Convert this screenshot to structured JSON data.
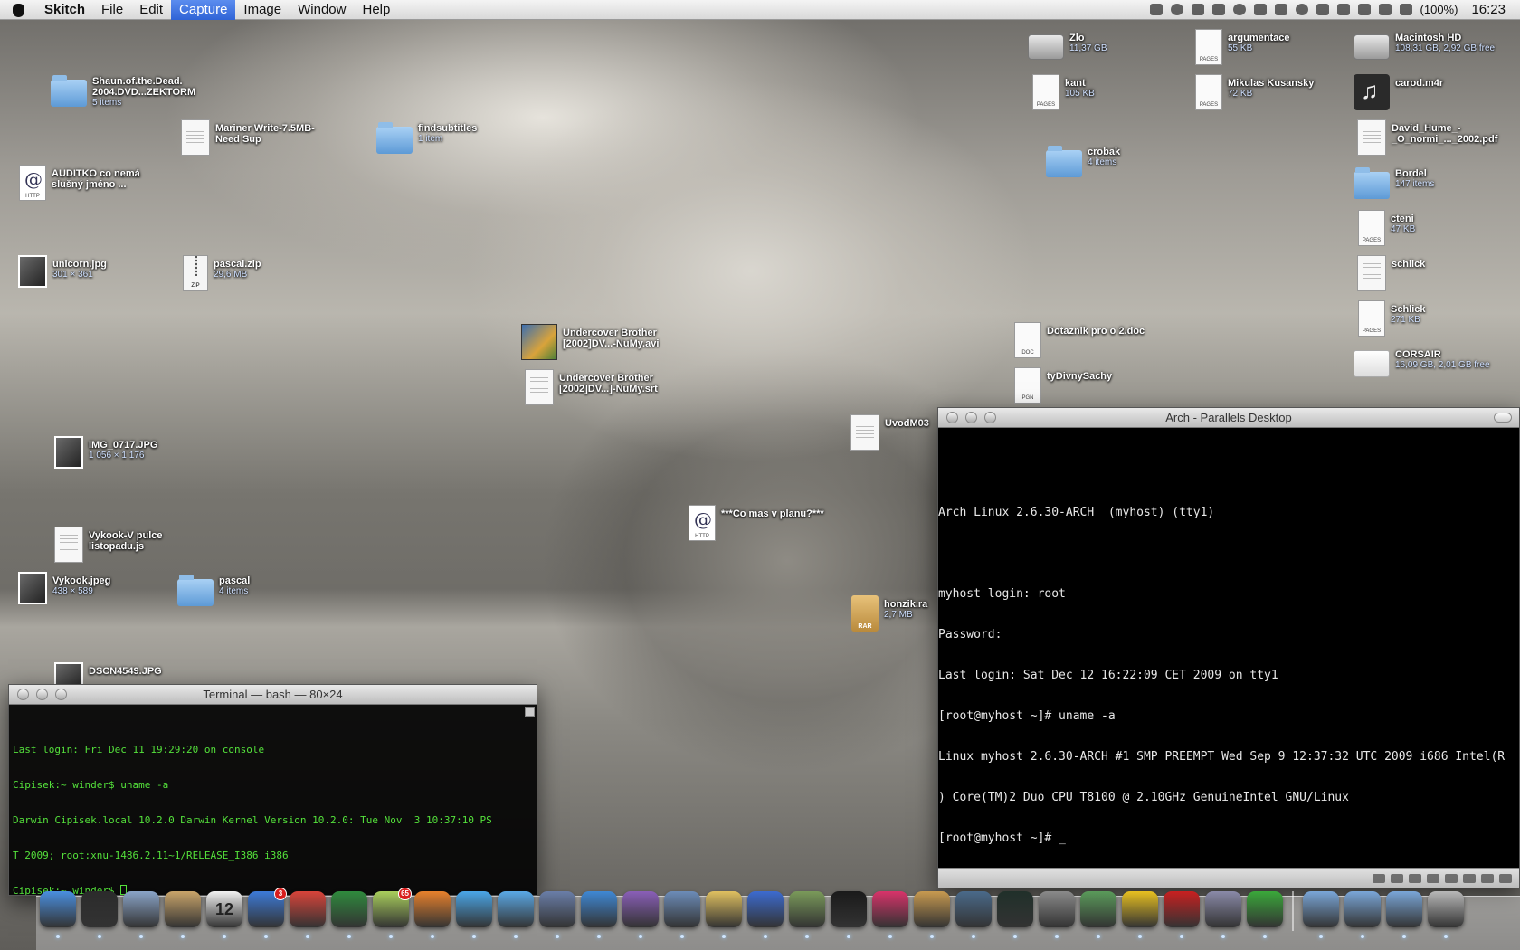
{
  "menubar": {
    "app_name": "Skitch",
    "menus": [
      "File",
      "Edit",
      "Capture",
      "Image",
      "Window",
      "Help"
    ],
    "active_menu": "Capture",
    "battery": "(100%)",
    "clock": "16:23"
  },
  "desktop_icons": [
    {
      "name": "Shaun.of.the.Dead.\n2004.DVD...ZEKTORM",
      "info": "5 items",
      "icon": "folder-icon"
    },
    {
      "name": "Mariner Write-7.5MB-\nNeed Sup",
      "info": "",
      "icon": "document-icon"
    },
    {
      "name": "findsubtitles",
      "info": "1 item",
      "icon": "folder-icon"
    },
    {
      "name": "AUDITKO co nemá\nslušný jméno ...",
      "info": "",
      "icon": "webloc-icon",
      "tag": "HTTP"
    },
    {
      "name": "unicorn.jpg",
      "info": "301 × 361",
      "icon": "image-icon"
    },
    {
      "name": "pascal.zip",
      "info": "29,6 MB",
      "icon": "zip-icon",
      "tag": "ZIP"
    },
    {
      "name": "Undercover Brother\n[2002]DV...-NuMy.avi",
      "info": "",
      "icon": "movie-icon"
    },
    {
      "name": "Undercover Brother\n[2002]DV...]-NuMy.srt",
      "info": "",
      "icon": "document-icon"
    },
    {
      "name": "IMG_0717.JPG",
      "info": "1 056 × 1 176",
      "icon": "image-icon"
    },
    {
      "name": "Vykook-V pulce\nlistopadu.js",
      "info": "",
      "icon": "document-icon"
    },
    {
      "name": "Vykook.jpeg",
      "info": "438 × 589",
      "icon": "image-icon"
    },
    {
      "name": "pascal",
      "info": "4 items",
      "icon": "folder-icon"
    },
    {
      "name": "DSCN4549.JPG",
      "info": "",
      "icon": "image-icon"
    },
    {
      "name": "***Co mas v planu?***",
      "info": "",
      "icon": "webloc-icon",
      "tag": "HTTP"
    },
    {
      "name": "UvodM03",
      "info": "",
      "icon": "document-icon"
    },
    {
      "name": "honzik.ra",
      "info": "2,7 MB",
      "icon": "rar-icon",
      "tag": "RAR"
    },
    {
      "name": "Zlo",
      "info": "11,37 GB",
      "icon": "hard-drive-icon"
    },
    {
      "name": "kant",
      "info": "105 KB",
      "icon": "pages-icon",
      "tag": "PAGES"
    },
    {
      "name": "crobak",
      "info": "4 items",
      "icon": "folder-icon"
    },
    {
      "name": "Dotaznik pro o 2.doc",
      "info": "",
      "icon": "doc-icon",
      "tag": "DOC"
    },
    {
      "name": "tyDivnySachy",
      "info": "",
      "icon": "pgn-icon",
      "tag": "PGN"
    },
    {
      "name": "argumentace",
      "info": "55 KB",
      "icon": "pages-icon",
      "tag": "PAGES"
    },
    {
      "name": "Mikulas Kusansky",
      "info": "72 KB",
      "icon": "pages-icon",
      "tag": "PAGES"
    },
    {
      "name": "Macintosh HD",
      "info": "108,31 GB, 2,92 GB free",
      "icon": "hard-drive-icon"
    },
    {
      "name": "carod.m4r",
      "info": "",
      "icon": "music-icon"
    },
    {
      "name": "David_Hume_-\n_O_normi_..._2002.pdf",
      "info": "",
      "icon": "pdf-icon"
    },
    {
      "name": "Bordel",
      "info": "147 items",
      "icon": "folder-icon"
    },
    {
      "name": "cteni",
      "info": "47 KB",
      "icon": "pages-icon",
      "tag": "PAGES"
    },
    {
      "name": "schlick",
      "info": "",
      "icon": "document-icon"
    },
    {
      "name": "Schlick",
      "info": "271 KB",
      "icon": "pages-icon",
      "tag": "PAGES"
    },
    {
      "name": "CORSAIR",
      "info": "16,09 GB, 2,01 GB free",
      "icon": "usb-drive-icon"
    }
  ],
  "terminal": {
    "title": "Terminal — bash — 80×24",
    "lines": [
      "Last login: Fri Dec 11 19:29:20 on console",
      "Cipisek:~ winder$ uname -a",
      "Darwin Cipisek.local 10.2.0 Darwin Kernel Version 10.2.0: Tue Nov  3 10:37:10 PS",
      "T 2009; root:xnu-1486.2.11~1/RELEASE_I386 i386",
      "Cipisek:~ winder$ "
    ]
  },
  "parallels": {
    "title": "Arch - Parallels Desktop",
    "lines": [
      "Arch Linux 2.6.30-ARCH  (myhost) (tty1)",
      "",
      "myhost login: root",
      "Password:",
      "Last login: Sat Dec 12 16:22:09 CET 2009 on tty1",
      "[root@myhost ~]# uname -a",
      "Linux myhost 2.6.30-ARCH #1 SMP PREEMPT Wed Sep 9 12:37:32 UTC 2009 i686 Intel(R",
      ") Core(TM)2 Duo CPU T8100 @ 2.10GHz GenuineIntel GNU/Linux",
      "[root@myhost ~]# _"
    ]
  },
  "dock": {
    "apps": [
      {
        "name": "finder-icon",
        "color": "#4a8fe0"
      },
      {
        "name": "dashboard-icon",
        "color": "#2b2b2b"
      },
      {
        "name": "mail-icon",
        "color": "#8aa4c8"
      },
      {
        "name": "address-book-icon",
        "color": "#c9a46a"
      },
      {
        "name": "ical-icon",
        "color": "#f2f2f2",
        "label": "12"
      },
      {
        "name": "things-icon",
        "color": "#3c7ad8",
        "badge": "3"
      },
      {
        "name": "chrome-icon",
        "color": "#d9443a"
      },
      {
        "name": "adium-icon",
        "color": "#2f8a3d"
      },
      {
        "name": "mojito-icon",
        "color": "#a9cf5c",
        "badge": "65"
      },
      {
        "name": "rss-icon",
        "color": "#e8812c"
      },
      {
        "name": "messenger-icon",
        "color": "#4aa6e8"
      },
      {
        "name": "itunes-icon",
        "color": "#5aa8e6"
      },
      {
        "name": "xcode-icon",
        "color": "#6a7ea8"
      },
      {
        "name": "quicktime-icon",
        "color": "#3f88d4"
      },
      {
        "name": "textmate-icon",
        "color": "#8a5fb8"
      },
      {
        "name": "dictionary-icon",
        "color": "#6c8cb8"
      },
      {
        "name": "pencil-icon",
        "color": "#e0c060"
      },
      {
        "name": "app-store-icon",
        "color": "#3c6bd0"
      },
      {
        "name": "automator-icon",
        "color": "#7a9a5a"
      },
      {
        "name": "terminal-icon",
        "color": "#1a1a1a"
      },
      {
        "name": "mesh-icon",
        "color": "#d8336a"
      },
      {
        "name": "iphoto-icon",
        "color": "#c89a50"
      },
      {
        "name": "time-machine-icon",
        "color": "#4a6a8a"
      },
      {
        "name": "activity-monitor-icon",
        "color": "#20302a"
      },
      {
        "name": "system-preferences-icon",
        "color": "#8a8a8a"
      },
      {
        "name": "preview-icon",
        "color": "#5a9a5a"
      },
      {
        "name": "cyberduck-icon",
        "color": "#e8c020"
      },
      {
        "name": "parallels-icon",
        "color": "#c82020"
      },
      {
        "name": "preview-icon-2",
        "color": "#8a8aa8"
      },
      {
        "name": "utorrent-icon",
        "color": "#3aa83a"
      }
    ],
    "stacks": [
      {
        "name": "documents-stack-icon",
        "color": "#7aa6d8"
      },
      {
        "name": "downloads-stack-icon",
        "color": "#7aa6d8"
      },
      {
        "name": "applications-stack-icon",
        "color": "#7aa6d8"
      },
      {
        "name": "trash-icon",
        "color": "#b8b8b8"
      }
    ]
  }
}
